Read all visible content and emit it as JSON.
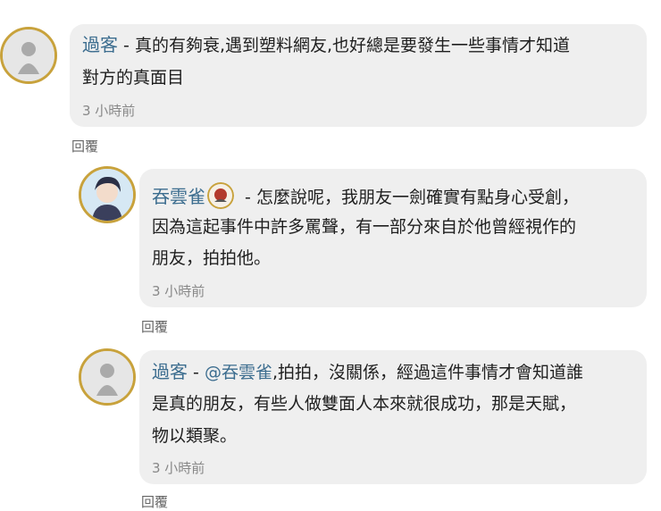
{
  "comments": [
    {
      "author": "過客",
      "separator": " - ",
      "lines": [
        "真的有夠衰,遇到塑料網友,也好總是要發生一些事情才知道",
        "對方的真面目"
      ],
      "time": "3 小時前",
      "reply": "回覆"
    },
    {
      "author": "吞雲雀",
      "separator": " - ",
      "lines": [
        "怎麼說呢，我朋友一劍確實有點身心受創，",
        "因為這起事件中許多罵聲，有一部分來自於他曾經視作的",
        "朋友，拍拍他。"
      ],
      "time": "3 小時前",
      "reply": "回覆"
    },
    {
      "author": "過客",
      "separator": " - ",
      "mention": "@吞雲雀",
      "lines": [
        ",拍拍，沒關係，經過這件事情才會知道誰",
        "是真的朋友，有些人做雙面人本來就很成功，那是天賦，",
        "物以類聚。"
      ],
      "time": "3 小時前",
      "reply": "回覆"
    }
  ]
}
